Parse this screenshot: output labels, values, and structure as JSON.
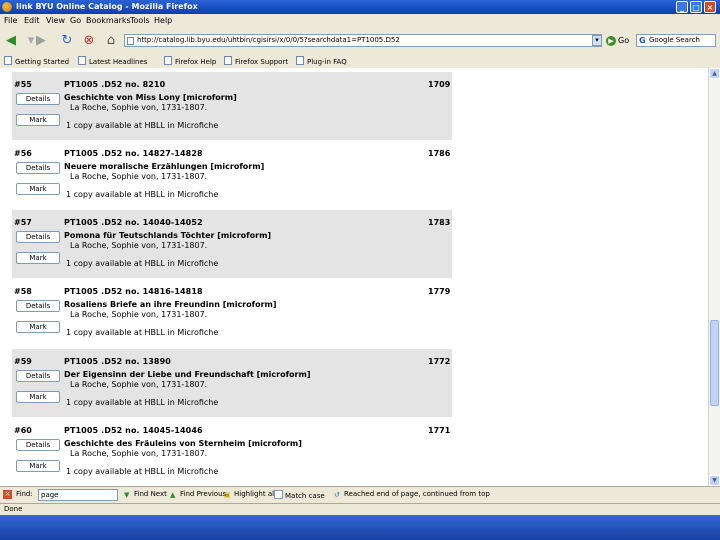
{
  "window": {
    "title": "Iink BYU Online Catalog - Mozilla Firefox"
  },
  "menu": [
    "File",
    "Edit",
    "View",
    "Go",
    "Bookmarks",
    "Tools",
    "Help"
  ],
  "nav": {
    "url": "http://catalog.lib.byu.edu/uhtbin/cgisirsi/x/0/0/5?searchdata1=PT1005.D52",
    "go_label": "Go",
    "search_value": "Google Search",
    "search_placeholder": "Google"
  },
  "bookmarks": [
    "Getting Started",
    "Latest Headlines",
    "Firefox Help",
    "Firefox Support",
    "Plug-in FAQ"
  ],
  "results": [
    {
      "num": "#55",
      "call": "PT1005 .D52 no. 8210",
      "year": "1709",
      "title": "Geschichte von Miss Lony [microform]",
      "author": "La Roche, Sophie von, 1731-1807.",
      "avail": "1 copy available at HBLL in Microfiche",
      "details": "Details",
      "mark": "Mark"
    },
    {
      "num": "#56",
      "call": "PT1005 .D52 no. 14827-14828",
      "year": "1786",
      "title": "Neuere moralische Erzählungen [microform]",
      "author": "La Roche, Sophie von, 1731-1807.",
      "avail": "1 copy available at HBLL in Microfiche",
      "details": "Details",
      "mark": "Mark"
    },
    {
      "num": "#57",
      "call": "PT1005 .D52 no. 14040-14052",
      "year": "1783",
      "title": "Pomona für Teutschlands Töchter [microform]",
      "author": "La Roche, Sophie von, 1731-1807.",
      "avail": "1 copy available at HBLL in Microfiche",
      "details": "Details",
      "mark": "Mark"
    },
    {
      "num": "#58",
      "call": "PT1005 .D52 no. 14816-14818",
      "year": "1779",
      "title": "Rosaliens Briefe an ihre Freundinn [microform]",
      "author": "La Roche, Sophie von, 1731-1807.",
      "avail": "1 copy available at HBLL in Microfiche",
      "details": "Details",
      "mark": "Mark"
    },
    {
      "num": "#59",
      "call": "PT1005 .D52 no. 13890",
      "year": "1772",
      "title": "Der Eigensinn der Liebe und Freundschaft [microform]",
      "author": "La Roche, Sophie von, 1731-1807.",
      "avail": "1 copy available at HBLL in Microfiche",
      "details": "Details",
      "mark": "Mark"
    },
    {
      "num": "#60",
      "call": "PT1005 .D52 no. 14045-14046",
      "year": "1771",
      "title": "Geschichte des Fräuleins von Sternheim [microform]",
      "author": "La Roche, Sophie von, 1731-1807.",
      "avail": "1 copy available at HBLL in Microfiche",
      "details": "Details",
      "mark": "Mark"
    }
  ],
  "findbar": {
    "label": "Find:",
    "value": "page",
    "next": "Find Next",
    "previous": "Find Previous",
    "highlight": "Highlight all",
    "match_case": "Match case",
    "message": "Reached end of page, continued from top"
  },
  "status": "Done"
}
